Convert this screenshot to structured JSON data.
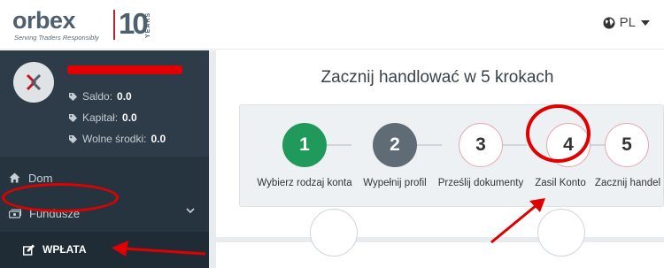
{
  "brand": {
    "logo_word": "orbex",
    "logo_tagline": "Serving Traders Responsibly",
    "logo_anniversary": "10",
    "logo_years": "YEARS",
    "accent": "#e00000"
  },
  "header": {
    "language": "PL",
    "language_icon": "globe-icon"
  },
  "profile": {
    "balance_label": "Saldo:",
    "balance_value": "0.0",
    "capital_label": "Kapitał:",
    "capital_value": "0.0",
    "free_funds_label": "Wolne środki:",
    "free_funds_value": "0.0"
  },
  "sidebar": {
    "home": "Dom",
    "funds": "Fundusze",
    "deposit": "WPŁATA"
  },
  "main": {
    "title": "Zacznij handlować w 5 krokach",
    "steps": [
      {
        "number": "1",
        "label": "Wybierz rodzaj konta",
        "state": "completed",
        "color": "#1f9a5a"
      },
      {
        "number": "2",
        "label": "Wypełnij profil",
        "state": "current",
        "color": "#5f6c76"
      },
      {
        "number": "3",
        "label": "Prześlij dokumenty",
        "state": "pending"
      },
      {
        "number": "4",
        "label": "Zasil Konto",
        "state": "pending"
      },
      {
        "number": "5",
        "label": "Zacznij handel",
        "state": "pending"
      }
    ]
  }
}
